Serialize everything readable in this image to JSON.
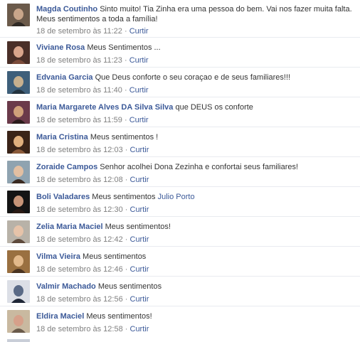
{
  "comments": [
    {
      "author": "Magda Coutinho",
      "text": "Sinto muito! Tia Zinha era uma pessoa do bem. Vai nos fazer muita falta. Meus sentimentos a toda a família!",
      "time": "18 de setembro às 11:22",
      "separator": "·",
      "like": "Curtir",
      "avatar_colors": [
        "#6b5a4a",
        "#c9a68a",
        "#2f2a25"
      ]
    },
    {
      "author": "Viviane Rosa",
      "text": "Meus Sentimentos ...",
      "time": "18 de setembro às 11:23",
      "separator": "·",
      "like": "Curtir",
      "avatar_colors": [
        "#4a2f28",
        "#d9a58c",
        "#7a4b3a"
      ]
    },
    {
      "author": "Edvania Garcia",
      "text": "Que Deus conforte o seu coraçao e de seus familiares!!!",
      "time": "18 de setembro às 11:40",
      "separator": "·",
      "like": "Curtir",
      "avatar_colors": [
        "#3e5f7a",
        "#c7b08e",
        "#23333f"
      ]
    },
    {
      "author": "Maria Margarete Alves DA Silva Silva",
      "text": "que DEUS os conforte",
      "time": "18 de setembro às 11:59",
      "separator": "·",
      "like": "Curtir",
      "avatar_colors": [
        "#6b3a4a",
        "#d0a07a",
        "#2b1b1b"
      ]
    },
    {
      "author": "Maria Cristina",
      "text": "Meus sentimentos !",
      "time": "18 de setembro às 12:03",
      "separator": "·",
      "like": "Curtir",
      "avatar_colors": [
        "#3a2418",
        "#e0b07e",
        "#8a5a3a"
      ]
    },
    {
      "author": "Zoraide Campos",
      "text": "Senhor acolhei Dona Zezinha e confortai seus familiares!",
      "time": "18 de setembro às 12:08",
      "separator": "·",
      "like": "Curtir",
      "avatar_colors": [
        "#8fa3b0",
        "#e2bfa2",
        "#3a2a22"
      ]
    },
    {
      "author": "Boli Valadares",
      "text": "Meus sentimentos",
      "tagged": "Julio Porto",
      "time": "18 de setembro às 12:30",
      "separator": "·",
      "like": "Curtir",
      "avatar_colors": [
        "#141414",
        "#c69478",
        "#2a1a14"
      ]
    },
    {
      "author": "Zelia Maria Maciel",
      "text": "Meus sentimentos!",
      "time": "18 de setembro às 12:42",
      "separator": "·",
      "like": "Curtir",
      "avatar_colors": [
        "#b8b2a8",
        "#e6c3a9",
        "#5e4a3c"
      ]
    },
    {
      "author": "Vilma Vieira",
      "text": "Meus sentimentos",
      "time": "18 de setembro às 12:46",
      "separator": "·",
      "like": "Curtir",
      "avatar_colors": [
        "#9a7040",
        "#e3b98a",
        "#4a3320"
      ]
    },
    {
      "author": "Valmir Machado",
      "text": "Meus sentimentos",
      "time": "18 de setembro às 12:56",
      "separator": "·",
      "like": "Curtir",
      "avatar_colors": [
        "#dcdfe6",
        "#5a6a86",
        "#1e2636"
      ]
    },
    {
      "author": "Eldira Maciel",
      "text": "Meus sentimentos!",
      "time": "18 de setembro às 12:58",
      "separator": "·",
      "like": "Curtir",
      "avatar_colors": [
        "#c9b9a0",
        "#d6a08a",
        "#6a5a4a"
      ]
    }
  ]
}
